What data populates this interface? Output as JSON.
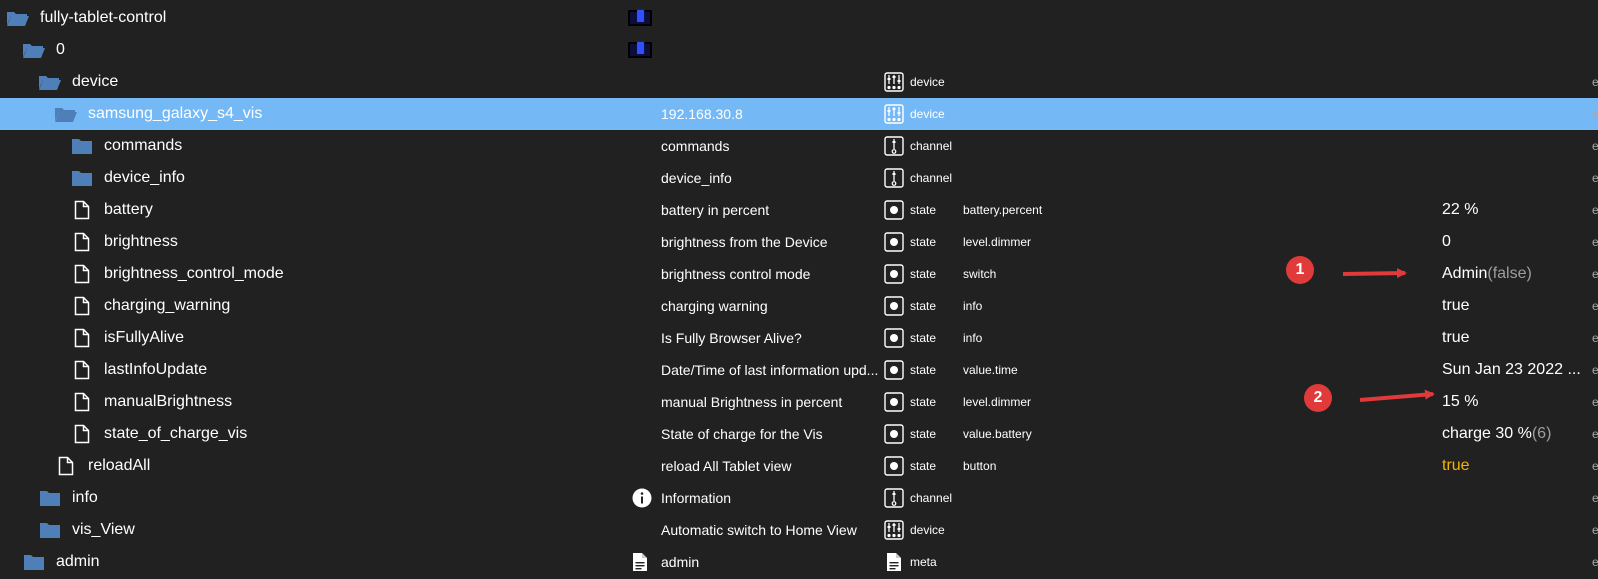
{
  "rows": [
    {
      "name": "fully-tablet-control",
      "indent": 6,
      "icon": "folder-open-icon",
      "desc": "",
      "type": "",
      "type_icon": "",
      "role": "",
      "value": "",
      "swatch": true
    },
    {
      "name": "0",
      "indent": 22,
      "icon": "folder-open-icon",
      "desc": "",
      "type": "",
      "type_icon": "",
      "role": "",
      "value": "",
      "swatch": true
    },
    {
      "name": "device",
      "indent": 38,
      "icon": "folder-open-icon",
      "desc": "",
      "type": "device",
      "type_icon": "device-icon",
      "role": "",
      "value": ""
    },
    {
      "name": "samsung_galaxy_s4_vis",
      "indent": 54,
      "icon": "folder-open-icon",
      "desc": "192.168.30.8",
      "type": "device",
      "type_icon": "device-icon",
      "role": "",
      "value": "",
      "selected": true
    },
    {
      "name": "commands",
      "indent": 70,
      "icon": "folder-icon",
      "desc": "commands",
      "type": "channel",
      "type_icon": "channel-icon",
      "role": "",
      "value": ""
    },
    {
      "name": "device_info",
      "indent": 70,
      "icon": "folder-icon",
      "desc": "device_info",
      "type": "channel",
      "type_icon": "channel-icon",
      "role": "",
      "value": ""
    },
    {
      "name": "battery",
      "indent": 70,
      "icon": "file-icon",
      "desc": "battery in percent",
      "type": "state",
      "type_icon": "state-icon",
      "role": "battery.percent",
      "value": "22 %"
    },
    {
      "name": "brightness",
      "indent": 70,
      "icon": "file-icon",
      "desc": "brightness from the Device",
      "type": "state",
      "type_icon": "state-icon",
      "role": "level.dimmer",
      "value": "0"
    },
    {
      "name": "brightness_control_mode",
      "indent": 70,
      "icon": "file-icon",
      "desc": "brightness control mode",
      "type": "state",
      "type_icon": "state-icon",
      "role": "switch",
      "value": "Admin",
      "value_extra": "(false)"
    },
    {
      "name": "charging_warning",
      "indent": 70,
      "icon": "file-icon",
      "desc": "charging warning",
      "type": "state",
      "type_icon": "state-icon",
      "role": "info",
      "value": "true"
    },
    {
      "name": "isFullyAlive",
      "indent": 70,
      "icon": "file-icon",
      "desc": "Is Fully Browser Alive?",
      "type": "state",
      "type_icon": "state-icon",
      "role": "info",
      "value": "true"
    },
    {
      "name": "lastInfoUpdate",
      "indent": 70,
      "icon": "file-icon",
      "desc": "Date/Time of last information upd...",
      "type": "state",
      "type_icon": "state-icon",
      "role": "value.time",
      "value": "Sun Jan 23 2022 ..."
    },
    {
      "name": "manualBrightness",
      "indent": 70,
      "icon": "file-icon",
      "desc": "manual Brightness in percent",
      "type": "state",
      "type_icon": "state-icon",
      "role": "level.dimmer",
      "value": "15 %"
    },
    {
      "name": "state_of_charge_vis",
      "indent": 70,
      "icon": "file-icon",
      "desc": "State of charge for the Vis",
      "type": "state",
      "type_icon": "state-icon",
      "role": "value.battery",
      "value": "charge 30 %",
      "value_extra": "(6)"
    },
    {
      "name": "reloadAll",
      "indent": 54,
      "icon": "file-icon",
      "desc": "reload All Tablet view",
      "type": "state",
      "type_icon": "state-icon",
      "role": "button",
      "value": "true",
      "value_style": "bool-true"
    },
    {
      "name": "info",
      "indent": 38,
      "icon": "folder-icon",
      "desc": "Information",
      "desc_icon": "info-icon",
      "type": "channel",
      "type_icon": "channel-icon",
      "role": "",
      "value": ""
    },
    {
      "name": "vis_View",
      "indent": 38,
      "icon": "folder-icon",
      "desc": "Automatic switch to Home View",
      "type": "device",
      "type_icon": "device-icon",
      "role": "",
      "value": ""
    },
    {
      "name": "admin",
      "indent": 22,
      "icon": "folder-icon",
      "desc": "admin",
      "desc_icon": "document-icon",
      "type": "meta",
      "type_icon": "document-icon",
      "role": "",
      "value": ""
    }
  ],
  "annotations": [
    {
      "label": "1",
      "row": 8
    },
    {
      "label": "2",
      "row": 12
    }
  ],
  "colors": {
    "selected_row": "#74b9f6",
    "folder": "#4f7fb8",
    "bool_true": "#f4b400",
    "annotation": "#e03a3a",
    "background": "#212121"
  },
  "edge_char": "e"
}
